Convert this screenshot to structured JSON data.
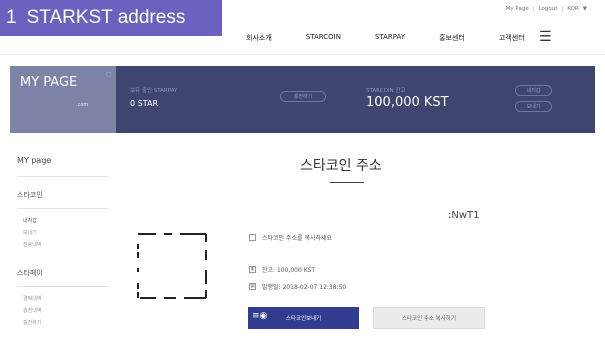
{
  "overlay": {
    "step": "1",
    "label": "STARKST address"
  },
  "util": {
    "mypage": "My Page",
    "logout": "Logout",
    "lang": "KOR",
    "sep": "|",
    "caret": "▼"
  },
  "nav": {
    "items": [
      "회사소개",
      "STARCOIN",
      "STARPAY",
      "홍보센터",
      "고객센터"
    ],
    "menu_icon": "hamburger-icon"
  },
  "banner": {
    "mypage_title": "MY PAGE",
    "mypage_sub": ".com",
    "starpay_label": "보유 중인 STARPAY",
    "starpay_value": "0 STAR",
    "charge_button": "충전하기",
    "starcoin_label": "STARCOIN 잔고",
    "starcoin_value": "100,000 KST",
    "wallet_button": "내지갑",
    "send_button": "보내기"
  },
  "sidebar": {
    "title": "MY page",
    "section1": "스타코인",
    "section1_items": [
      "내지갑",
      "보내기",
      "전송내역"
    ],
    "section2": "스타페이",
    "section2_items": [
      "결제내역",
      "충전내역",
      "충전하기"
    ]
  },
  "content": {
    "title": "스타코인 주소",
    "address_suffix": ":NwT1",
    "copy_hint": "스타코인 주소를 복사하세요",
    "balance": "잔고: 100,000 KST",
    "issued": "발행일: 2018-02-07 12:38:50",
    "send_button": "스타코인보내기",
    "copy_button": "스타코인 주소 복사하기"
  },
  "colors": {
    "banner": "#3e4670",
    "mypage_block": "#7c83a6",
    "primary_button": "#2f3c8f",
    "overlay": "#6b62bf"
  }
}
